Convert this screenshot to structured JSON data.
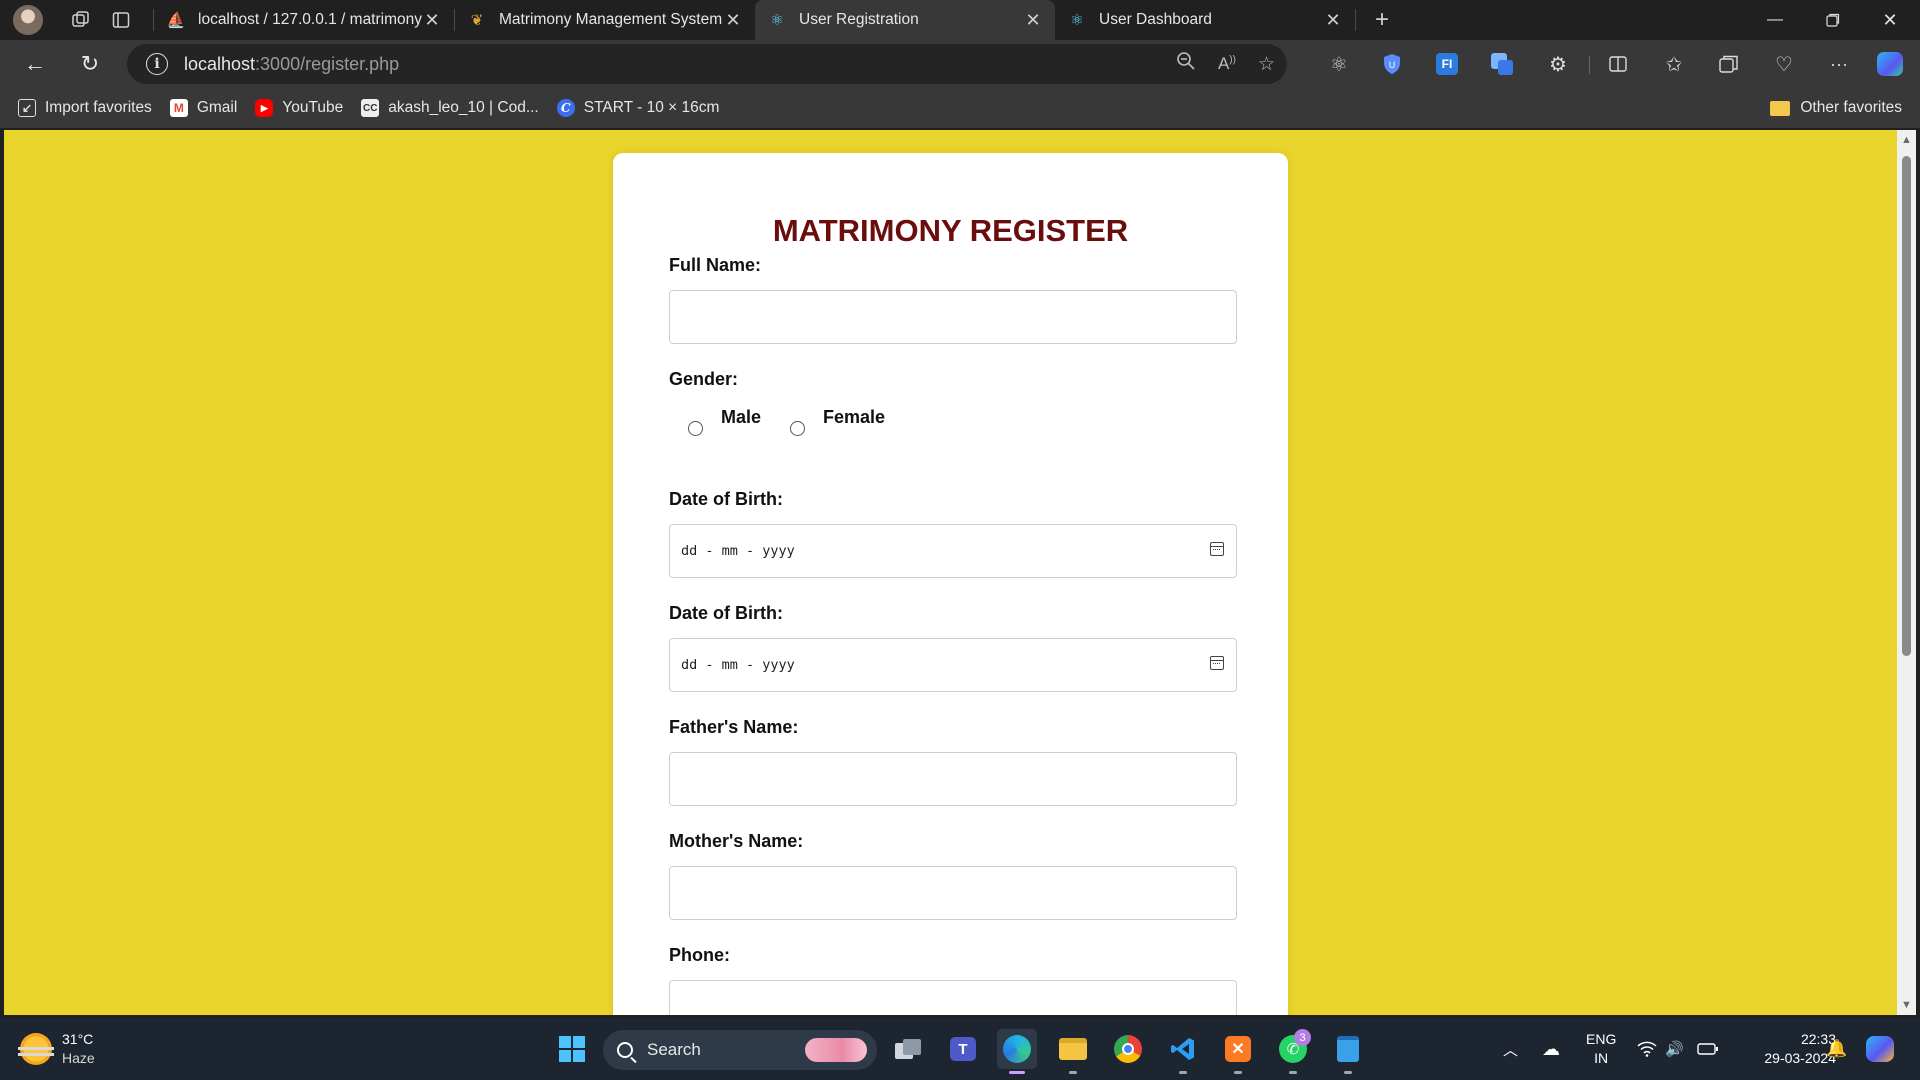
{
  "browser": {
    "tabs": [
      {
        "title": "localhost / 127.0.0.1 / matrimony",
        "icon": "phpmyadmin-icon",
        "active": false
      },
      {
        "title": "Matrimony Management System",
        "icon": "matrimony-icon",
        "active": false
      },
      {
        "title": "User Registration",
        "icon": "react-icon",
        "active": true
      },
      {
        "title": "User Dashboard",
        "icon": "react-icon",
        "active": false
      }
    ],
    "address": {
      "host": "localhost",
      "path": ":3000/register.php"
    },
    "favorites": [
      {
        "label": "Import favorites",
        "icon": "import-icon"
      },
      {
        "label": "Gmail",
        "icon": "gmail-icon"
      },
      {
        "label": "YouTube",
        "icon": "youtube-icon"
      },
      {
        "label": "akash_leo_10 | Cod...",
        "icon": "codechef-icon"
      },
      {
        "label": "START - 10 × 16cm",
        "icon": "canva-icon"
      }
    ],
    "other_favorites": "Other favorites"
  },
  "form": {
    "title": "MATRIMONY REGISTER",
    "full_name_label": "Full Name:",
    "gender_label": "Gender:",
    "gender_options": [
      "Male",
      "Female"
    ],
    "dob_label_1": "Date of Birth:",
    "dob_label_2": "Date of Birth:",
    "date_placeholder": "dd - mm - yyyy",
    "father_label": "Father's Name:",
    "mother_label": "Mother's Name:",
    "phone_label": "Phone:",
    "background_color": "#e8d42a",
    "title_color": "#6b0d0d"
  },
  "taskbar": {
    "weather": {
      "temp": "31°C",
      "condition": "Haze"
    },
    "search_label": "Search",
    "whatsapp_badge": "3",
    "language": {
      "line1": "ENG",
      "line2": "IN"
    },
    "time": "22:33",
    "date": "29-03-2024"
  }
}
